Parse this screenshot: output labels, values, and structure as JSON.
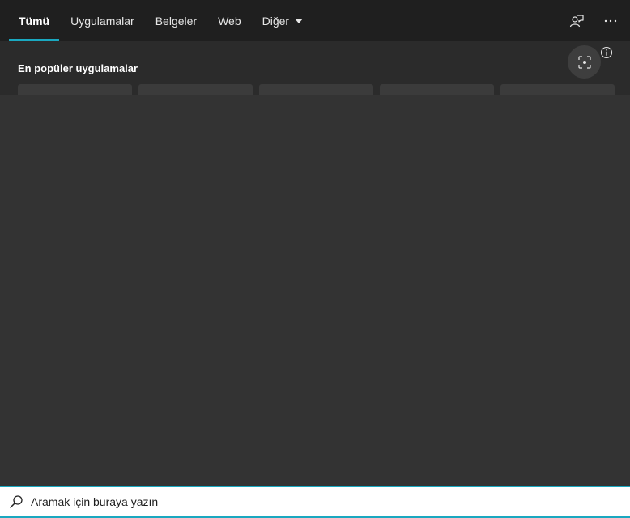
{
  "tabs": [
    {
      "label": "Tümü",
      "active": true
    },
    {
      "label": "Uygulamalar",
      "active": false
    },
    {
      "label": "Belgeler",
      "active": false
    },
    {
      "label": "Web",
      "active": false
    },
    {
      "label": "Diğer",
      "active": false,
      "has_dropdown": true
    }
  ],
  "top_icons": {
    "feedback": "feedback-icon",
    "more": "more-icon"
  },
  "section": {
    "title": "En popüler uygulamalar"
  },
  "search": {
    "value": "",
    "placeholder": "Aramak için buraya yazın"
  },
  "colors": {
    "accent": "#1aa8c0",
    "topbar": "#1f1f1f",
    "panel": "#333333"
  }
}
